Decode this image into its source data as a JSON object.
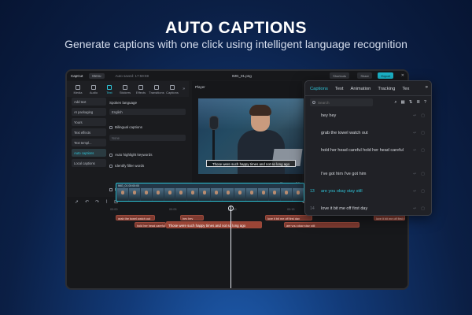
{
  "hero": {
    "title": "AUTO CAPTIONS",
    "subtitle": "Generate captions with one click using intelligent language recognition"
  },
  "app": {
    "name": "CapCut",
    "menu": "Menu",
    "saved": "Auto saved: 17:59:59",
    "filename": "IMG_01.png",
    "shortcuts": "Shortcuts",
    "share": "Share",
    "export": "Export"
  },
  "toolstrip": [
    {
      "label": "Media",
      "icon": "media-icon"
    },
    {
      "label": "Audio",
      "icon": "audio-icon"
    },
    {
      "label": "Text",
      "icon": "text-icon"
    },
    {
      "label": "Stickers",
      "icon": "stickers-icon"
    },
    {
      "label": "Effects",
      "icon": "effects-icon"
    },
    {
      "label": "Transitions",
      "icon": "transitions-icon"
    },
    {
      "label": "Captions",
      "icon": "captions-icon"
    }
  ],
  "left_nav": [
    "Add text",
    "AI packaging",
    "Yours",
    "Text effects",
    "Text templ...",
    "Auto captions",
    "Local captions"
  ],
  "settings": {
    "spoken_language_label": "Spoken language",
    "spoken_language_value": "English",
    "bilingual_label": "Bilingual captions",
    "bilingual_value": "None",
    "highlight_label": "Auto highlight keywords",
    "filler_label": "Identify filler words",
    "delete_label": "Delete current captions",
    "generate_label": "Generate"
  },
  "player": {
    "label": "Player",
    "subtitle": "Those were such happy times and not so long ago",
    "timecode": "00:00:05:21",
    "duration": "00:00:31:21"
  },
  "timeline": {
    "ruler": [
      "00:00",
      "00:05",
      "|00:10",
      "00:15",
      "00:20"
    ],
    "captions_top": [
      "grab the towel watch out",
      "hey hey",
      "love it bit me off first day",
      "love it bit me off first day"
    ],
    "captions_mid": [
      "hold her head careful",
      "Those were such happy times and not so long ago",
      "are you okay stay still"
    ],
    "video_label": "IMG_01  00:00:00"
  },
  "panel": {
    "tabs": [
      "Captions",
      "Text",
      "Animation",
      "Tracking",
      "Tex"
    ],
    "search_placeholder": "Search",
    "rows": [
      {
        "num": "",
        "text": "hey hey"
      },
      {
        "num": "",
        "text": "grab the towel watch out"
      },
      {
        "num": "",
        "text": "hold her head careful hold her head careful"
      },
      {
        "num": "",
        "text": "I've got him I've got him"
      },
      {
        "num": "13",
        "text": "are you okay stay still"
      },
      {
        "num": "14",
        "text": "love it bit me off first day"
      }
    ]
  },
  "colors": {
    "accent": "#2ec4d8",
    "caption_clip": "#7e3a30",
    "background": "#0b1f45"
  }
}
